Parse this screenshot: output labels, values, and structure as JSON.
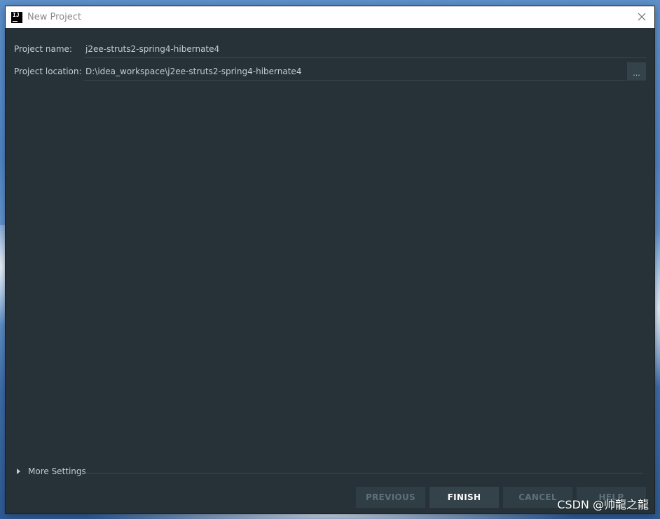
{
  "window": {
    "title": "New Project",
    "app_icon_text": "IJ"
  },
  "form": {
    "project_name_label": "Project name:",
    "project_name_value": "j2ee-struts2-spring4-hibernate4",
    "project_location_label": "Project location:",
    "project_location_value": "D:\\idea_workspace\\j2ee-struts2-spring4-hibernate4",
    "browse_label": "..."
  },
  "more_settings": {
    "label": "More Settings"
  },
  "buttons": {
    "previous": "PREVIOUS",
    "finish": "FINISH",
    "cancel": "CANCEL",
    "help": "HELP"
  },
  "watermark": "CSDN @帅龍之龍",
  "colors": {
    "dialog_bg": "#263238",
    "text": "#c3cdd2",
    "primary_button_text": "#ffffff",
    "disabled_button_text": "#5f7078"
  }
}
